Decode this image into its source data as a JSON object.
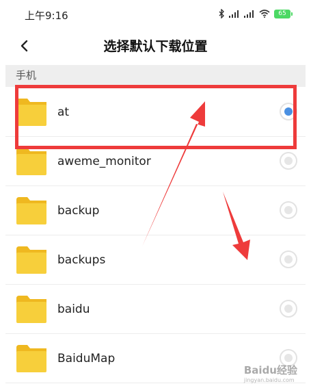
{
  "status_bar": {
    "time": "上午9:16",
    "battery": "65",
    "icons": [
      "bluetooth-icon",
      "signal-icon",
      "signal-icon",
      "wifi-icon",
      "battery-icon"
    ]
  },
  "header": {
    "title": "选择默认下载位置",
    "back_icon": "chevron-left-icon"
  },
  "section": {
    "label": "手机"
  },
  "folders": [
    {
      "name": "at",
      "selected": true
    },
    {
      "name": "aweme_monitor",
      "selected": false
    },
    {
      "name": "backup",
      "selected": false
    },
    {
      "name": "backups",
      "selected": false
    },
    {
      "name": "baidu",
      "selected": false
    },
    {
      "name": "BaiduMap",
      "selected": false
    }
  ],
  "colors": {
    "folder": "#f7cf3b",
    "folder_tab": "#efb820",
    "radio_selected": "#4a90e2",
    "annotation": "#ee3b3b",
    "battery": "#4cd964"
  },
  "watermark": {
    "text": "Baidu经验",
    "url": "jingyan.baidu.com"
  }
}
